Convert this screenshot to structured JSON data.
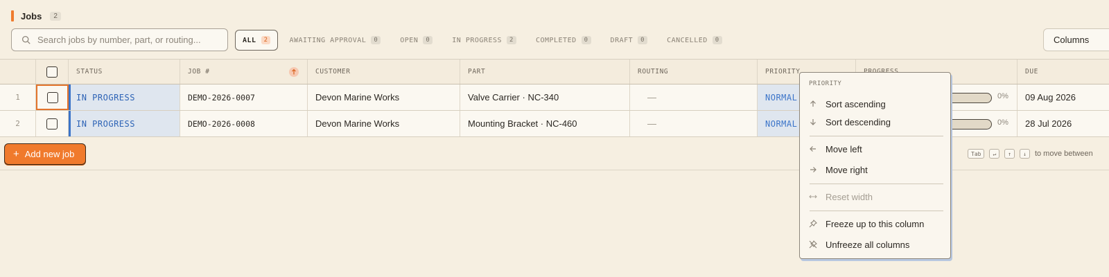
{
  "header": {
    "title": "Jobs",
    "count": "2"
  },
  "search": {
    "placeholder": "Search jobs by number, part, or routing..."
  },
  "tabs": [
    {
      "label": "ALL",
      "count": "2"
    },
    {
      "label": "AWAITING APPROVAL",
      "count": "0"
    },
    {
      "label": "OPEN",
      "count": "0"
    },
    {
      "label": "IN PROGRESS",
      "count": "2"
    },
    {
      "label": "COMPLETED",
      "count": "0"
    },
    {
      "label": "DRAFT",
      "count": "0"
    },
    {
      "label": "CANCELLED",
      "count": "0"
    }
  ],
  "columns_button": "Columns",
  "table": {
    "columns": {
      "status": "STATUS",
      "job": "JOB #",
      "customer": "CUSTOMER",
      "part": "PART",
      "routing": "ROUTING",
      "priority": "PRIORITY",
      "progress": "PROGRESS",
      "due": "DUE"
    },
    "rows": [
      {
        "index": "1",
        "status": "IN PROGRESS",
        "job": "DEMO-2026-0007",
        "customer": "Devon Marine Works",
        "part": "Valve Carrier · NC-340",
        "routing": "—",
        "priority": "NORMAL",
        "progress": "0%",
        "due": "09 Aug 2026"
      },
      {
        "index": "2",
        "status": "IN PROGRESS",
        "job": "DEMO-2026-0008",
        "customer": "Devon Marine Works",
        "part": "Mounting Bracket · NC-460",
        "routing": "—",
        "priority": "NORMAL",
        "progress": "0%",
        "due": "28 Jul 2026"
      }
    ]
  },
  "add_button": "Add new job",
  "hint": {
    "keys": [
      "Tab",
      "↵",
      "↑",
      "↓"
    ],
    "text": "to move between"
  },
  "menu": {
    "heading": "PRIORITY",
    "sort_asc": "Sort ascending",
    "sort_desc": "Sort descending",
    "move_left": "Move left",
    "move_right": "Move right",
    "reset_width": "Reset width",
    "freeze": "Freeze up to this column",
    "unfreeze": "Unfreeze all columns"
  },
  "colors": {
    "accent": "#f07a2c",
    "status_blue": "#2d63b6",
    "background": "#f6efe1"
  }
}
